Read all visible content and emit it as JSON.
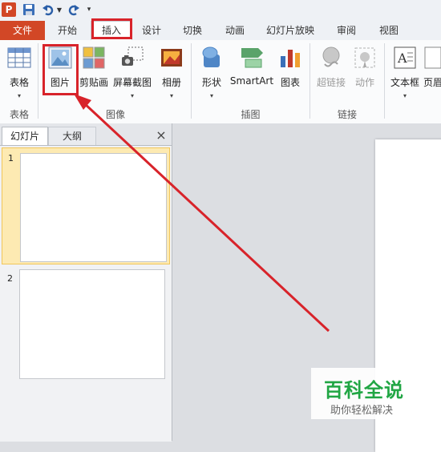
{
  "quick_access": {
    "app_icon": "P",
    "save_icon": "save-icon",
    "undo_icon": "undo-icon",
    "redo_icon": "redo-icon"
  },
  "tabs": {
    "file": "文件",
    "home": "开始",
    "insert": "插入",
    "design": "设计",
    "transitions": "切换",
    "animations": "动画",
    "slideshow": "幻灯片放映",
    "review": "审阅",
    "view": "视图"
  },
  "ribbon": {
    "table": "表格",
    "picture": "图片",
    "clipart": "剪贴画",
    "screenshot": "屏幕截图",
    "album": "相册",
    "shapes": "形状",
    "smartart": "SmartArt",
    "chart": "图表",
    "hyperlink": "超链接",
    "action": "动作",
    "textbox": "文本框",
    "header": "页眉",
    "groups": {
      "tables": "表格",
      "images": "图像",
      "illustrations": "插图",
      "links": "链接"
    }
  },
  "panel": {
    "tab_slides": "幻灯片",
    "tab_outline": "大纲",
    "close": "×",
    "slides": [
      "1",
      "2"
    ]
  },
  "watermark": {
    "title": "百科全说",
    "subtitle": "助你轻松解决"
  },
  "colors": {
    "file_tab": "#d24726",
    "highlight": "#d8232a",
    "watermark": "#21a644",
    "selected_slide": "#fdeab2"
  }
}
